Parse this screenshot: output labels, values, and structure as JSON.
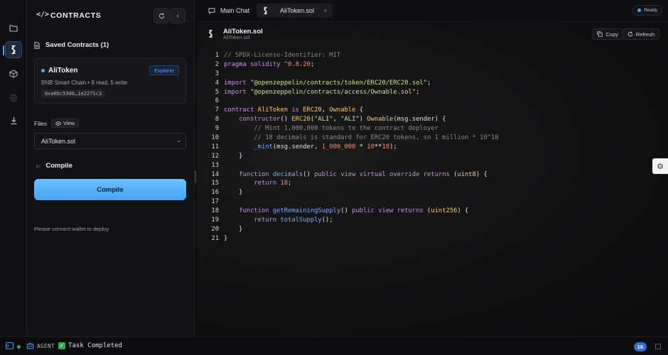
{
  "sidebar": {
    "title": "CONTRACTS",
    "saved_title": "Saved Contracts (1)",
    "contract": {
      "name": "AliToken",
      "explorer_label": "Explorer",
      "meta": "BNB Smart Chain • 8 read, 5 write",
      "address": "0xa0bc5306…1e2271c3"
    },
    "files_label": "Files",
    "view_label": "View",
    "selected_file": "AliToken.sol",
    "compile_section_label": "Compile",
    "compile_button_label": "Compile",
    "deploy_hint": "Please connect wallet to deploy"
  },
  "tabs": [
    {
      "label": "Main Chat",
      "icon": "chat-icon"
    },
    {
      "label": "AliToken.sol",
      "icon": "solidity-icon",
      "active": true
    }
  ],
  "status_badge": "Ready",
  "file_header": {
    "title": "AliToken.sol",
    "subtitle": "AliToken.sol",
    "copy_label": "Copy",
    "refresh_label": "Refresh"
  },
  "code_lines": [
    "// SPDX-License-Identifier: MIT",
    "pragma solidity ^0.8.20;",
    "",
    "import \"@openzeppelin/contracts/token/ERC20/ERC20.sol\";",
    "import \"@openzeppelin/contracts/access/Ownable.sol\";",
    "",
    "contract AliToken is ERC20, Ownable {",
    "    constructor() ERC20(\"ALI\", \"ALI\") Ownable(msg.sender) {",
    "        // Mint 1,000,000 tokens to the contract deployer",
    "        // 18 decimals is standard for ERC20 tokens, so 1 million * 10^18",
    "        _mint(msg.sender, 1_000_000 * 10**18);",
    "    }",
    "",
    "    function decimals() public view virtual override returns (uint8) {",
    "        return 18;",
    "    }",
    "",
    "    function getRemainingSupply() public view returns (uint256) {",
    "        return totalSupply();",
    "    }",
    "}"
  ],
  "statusbar": {
    "agent_label": "AGENT",
    "task_label": "Task Completed",
    "count": "16"
  },
  "colors": {
    "accent": "#4aa3ff",
    "compile_button": "#5bb4fb",
    "success": "#2fa84f"
  }
}
